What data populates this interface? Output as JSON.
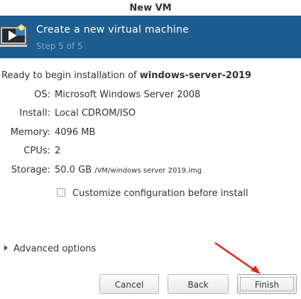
{
  "window": {
    "title": "New VM"
  },
  "banner": {
    "title": "Create a new virtual machine",
    "step": "Step 5 of 5",
    "icon": "vm-monitor-icon"
  },
  "summary": {
    "ready_prefix": "Ready to begin installation of ",
    "vm_name": "windows-server-2019",
    "rows": [
      {
        "label": "OS:",
        "value": "Microsoft Windows Server 2008",
        "sub": ""
      },
      {
        "label": "Install:",
        "value": "Local CDROM/ISO",
        "sub": ""
      },
      {
        "label": "Memory:",
        "value": "4096 MB",
        "sub": ""
      },
      {
        "label": "CPUs:",
        "value": "2",
        "sub": ""
      },
      {
        "label": "Storage:",
        "value": "50.0 GB",
        "sub": "/VM/windows server 2019.img"
      }
    ]
  },
  "options": {
    "customize_label": "Customize configuration before install",
    "customize_checked": false,
    "advanced_label": "Advanced options"
  },
  "buttons": {
    "cancel": "Cancel",
    "back": "Back",
    "finish": "Finish"
  },
  "annotation": {
    "arrow_color": "#e0261b"
  }
}
